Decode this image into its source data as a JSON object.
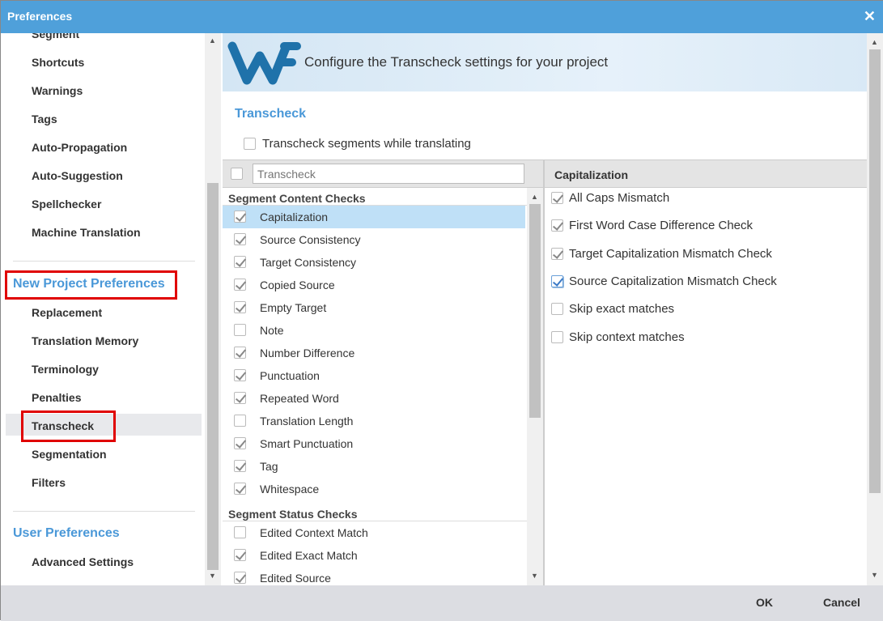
{
  "window": {
    "title": "Preferences",
    "close_icon": "close-icon"
  },
  "sidebar": {
    "items_top": [
      "Segment",
      "Shortcuts",
      "Warnings",
      "Tags",
      "Auto-Propagation",
      "Auto-Suggestion",
      "Spellchecker",
      "Machine Translation"
    ],
    "section_project": "New Project Preferences",
    "items_project": [
      "Replacement",
      "Translation Memory",
      "Terminology",
      "Penalties",
      "Transcheck",
      "Segmentation",
      "Filters"
    ],
    "selected": "Transcheck",
    "section_user": "User Preferences",
    "items_user": [
      "Advanced Settings"
    ]
  },
  "banner": {
    "logo": "WF",
    "text": "Configure the Transcheck settings for your project"
  },
  "main": {
    "heading": "Transcheck",
    "while_translating": {
      "label": "Transcheck segments while translating",
      "checked": false
    },
    "filter": {
      "value": "",
      "placeholder": "Transcheck"
    },
    "groups": [
      {
        "title": "Segment Content Checks",
        "items": [
          {
            "label": "Capitalization",
            "checked": true,
            "selected": true
          },
          {
            "label": "Source Consistency",
            "checked": true
          },
          {
            "label": "Target Consistency",
            "checked": true
          },
          {
            "label": "Copied Source",
            "checked": true
          },
          {
            "label": "Empty Target",
            "checked": true
          },
          {
            "label": "Note",
            "checked": false
          },
          {
            "label": "Number Difference",
            "checked": true
          },
          {
            "label": "Punctuation",
            "checked": true
          },
          {
            "label": "Repeated Word",
            "checked": true
          },
          {
            "label": "Translation Length",
            "checked": false
          },
          {
            "label": "Smart Punctuation",
            "checked": true
          },
          {
            "label": "Tag",
            "checked": true
          },
          {
            "label": "Whitespace",
            "checked": true
          }
        ]
      },
      {
        "title": "Segment Status Checks",
        "items": [
          {
            "label": "Edited Context Match",
            "checked": false
          },
          {
            "label": "Edited Exact Match",
            "checked": true
          },
          {
            "label": "Edited Source",
            "checked": true
          }
        ]
      }
    ],
    "detail": {
      "title": "Capitalization",
      "items": [
        {
          "label": "All Caps Mismatch",
          "checked": true
        },
        {
          "label": "First Word Case Difference Check",
          "checked": true
        },
        {
          "label": "Target Capitalization Mismatch Check",
          "checked": true
        },
        {
          "label": "Source Capitalization Mismatch Check",
          "checked": true,
          "focused": true
        },
        {
          "label": "Skip exact matches",
          "checked": false
        },
        {
          "label": "Skip context matches",
          "checked": false
        }
      ]
    }
  },
  "footer": {
    "ok": "OK",
    "cancel": "Cancel"
  },
  "colors": {
    "titlebar": "#4fa0da",
    "accent": "#4a98d8",
    "selection": "#bfe0f7",
    "highlight_box": "#e00000"
  }
}
